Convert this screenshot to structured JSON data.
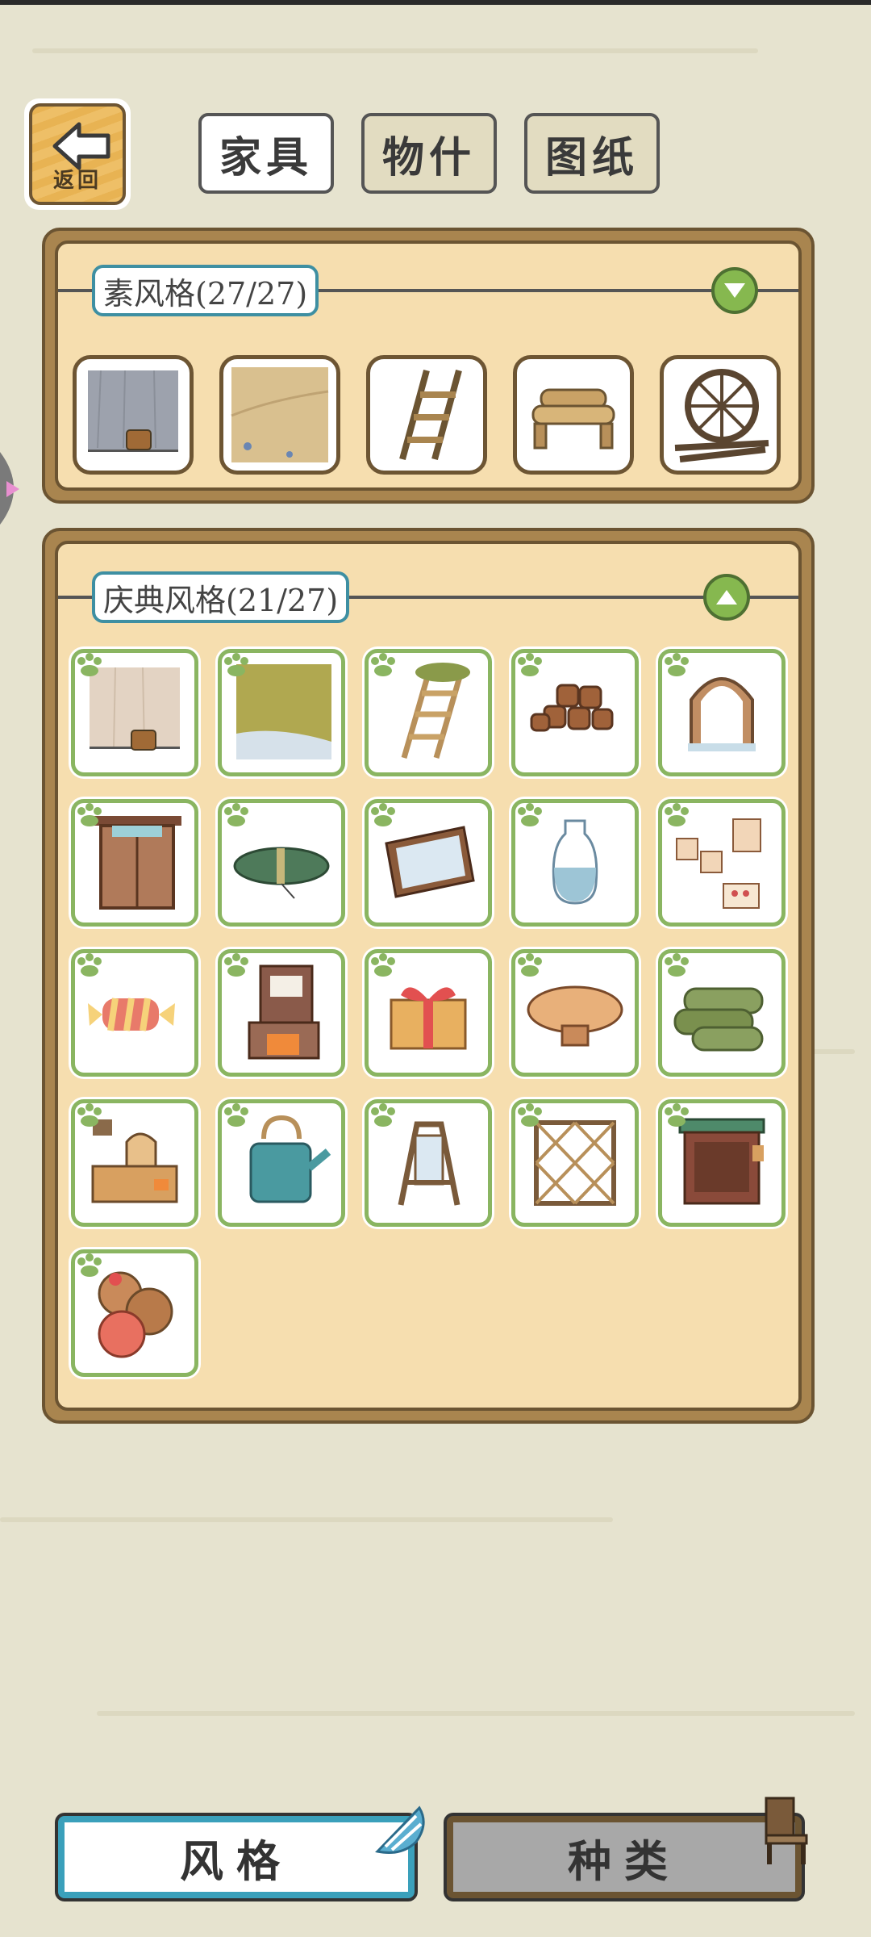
{
  "back_button": {
    "label": "返回",
    "icon": "back-arrow-icon"
  },
  "tabs": [
    {
      "label": "家具",
      "active": true
    },
    {
      "label": "物什",
      "active": false
    },
    {
      "label": "图纸",
      "active": false
    }
  ],
  "sections": [
    {
      "label": "素风格(27/27)",
      "toggle": "collapse-down-icon",
      "items": [
        "gray-wall-with-bucket-icon",
        "sand-floor-icon",
        "wooden-ladder-icon",
        "log-bench-icon",
        "round-window-icon"
      ]
    },
    {
      "label": "庆典风格(21/27)",
      "toggle": "expand-up-icon",
      "items": [
        "wood-wall-with-bucket-icon",
        "grass-floor-icon",
        "mossy-ladder-icon",
        "wooden-stools-icon",
        "arched-window-icon",
        "wooden-door-icon",
        "green-cushion-icon",
        "mirror-tray-icon",
        "glass-vase-icon",
        "photo-notes-icon",
        "candy-pillow-icon",
        "fireplace-cabinet-icon",
        "gift-box-icon",
        "mushroom-table-icon",
        "rolled-mats-icon",
        "kitchen-stove-icon",
        "watering-can-icon",
        "standing-mirror-icon",
        "lattice-screen-icon",
        "green-top-cabinet-icon",
        "fruit-sacks-icon"
      ]
    }
  ],
  "bottom_buttons": {
    "style_label": "风格",
    "kind_label": "种类"
  },
  "colors": {
    "background": "#e6e3cf",
    "panel": "#f6deaf",
    "accent_blue": "#3aa0bb",
    "frog_green": "#8ab561"
  }
}
